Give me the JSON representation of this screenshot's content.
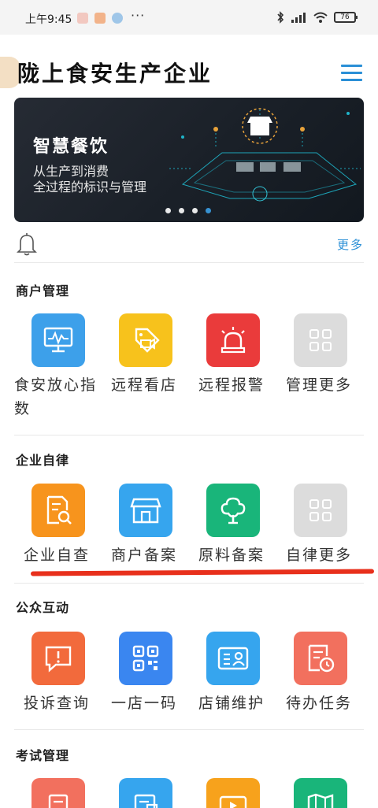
{
  "status_bar": {
    "time": "上午9:45",
    "dots": "···",
    "battery": "76"
  },
  "header": {
    "title": "陇上食安生产企业"
  },
  "banner": {
    "title": "智慧餐饮",
    "subtitle_line1": "从生产到消费",
    "subtitle_line2": "全过程的标识与管理",
    "slide_count": 4,
    "active_slide": 4
  },
  "notice": {
    "more": "更多"
  },
  "sections": [
    {
      "title": "商户管理",
      "items": [
        {
          "label_line1": "食安放心指",
          "label_line2": "数",
          "icon": "monitor-chart-icon",
          "color": "#3da0ea"
        },
        {
          "label_line1": "远程看店",
          "icon": "tag-video-icon",
          "color": "#f7c21c"
        },
        {
          "label_line1": "远程报警",
          "icon": "alarm-light-icon",
          "color": "#ea3b3b"
        },
        {
          "label_line1": "管理更多",
          "icon": "grid-more-icon",
          "color": "#dcdcdc"
        }
      ]
    },
    {
      "title": "企业自律",
      "items": [
        {
          "label_line1": "企业自查",
          "icon": "document-search-icon",
          "color": "#f7941d"
        },
        {
          "label_line1": "商户备案",
          "icon": "storefront-icon",
          "color": "#36a5ee"
        },
        {
          "label_line1": "原料备案",
          "icon": "tree-icon",
          "color": "#19b57a"
        },
        {
          "label_line1": "自律更多",
          "icon": "grid-more-icon",
          "color": "#dcdcdc"
        }
      ]
    },
    {
      "title": "公众互动",
      "items": [
        {
          "label_line1": "投诉查询",
          "icon": "message-alert-icon",
          "color": "#f26a3c"
        },
        {
          "label_line1": "一店一码",
          "icon": "qr-code-icon",
          "color": "#3a86f0"
        },
        {
          "label_line1": "店铺维护",
          "icon": "id-card-icon",
          "color": "#36a5ee"
        },
        {
          "label_line1": "待办任务",
          "icon": "task-clock-icon",
          "color": "#f2705e"
        }
      ]
    },
    {
      "title": "考试管理",
      "items": [
        {
          "icon": "exam-document-icon",
          "color": "#f2705e"
        },
        {
          "icon": "exam-list-icon",
          "color": "#36a5ee"
        },
        {
          "icon": "video-play-icon",
          "color": "#f7a21c"
        },
        {
          "icon": "book-map-icon",
          "color": "#19b57a"
        }
      ]
    }
  ]
}
